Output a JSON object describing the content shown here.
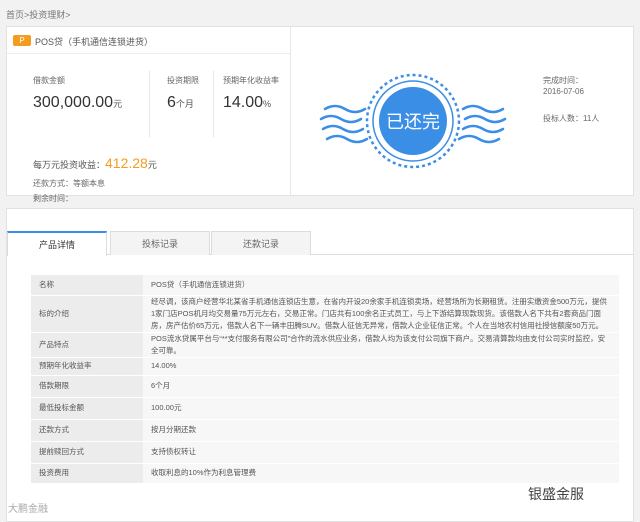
{
  "breadcrumb": {
    "home": "首页",
    "sep": ">",
    "section": "投资理财",
    "sep2": ">"
  },
  "product": {
    "badge": "P",
    "title": "POS贷（手机通信连锁进货）"
  },
  "stats": {
    "amount_label": "借款金额",
    "amount_value": "300,000.00",
    "amount_unit": "元",
    "term_label": "投资期限",
    "term_value": "6",
    "term_unit": "个月",
    "rate_label": "预期年化收益率",
    "rate_value": "14.00",
    "rate_unit": "%"
  },
  "earn": {
    "label": "每万元投资收益：",
    "value": "412.28",
    "unit": "元"
  },
  "repay": {
    "label": "还款方式：",
    "value": "等额本息"
  },
  "remain": {
    "label": "剩余时间：",
    "value": ""
  },
  "stamp": {
    "text": "已还完"
  },
  "done": {
    "time_label": "完成时间：",
    "time_value": "2016-07-06",
    "investors": "投标人数：11人"
  },
  "tabs": [
    "产品详情",
    "投标记录",
    "还款记录"
  ],
  "details": [
    {
      "k": "名称",
      "v": "POS贷（手机通信连锁进货）"
    },
    {
      "k": "标的介绍",
      "v": "经尽调，该商户经营华北某省手机通信连锁店生意，在省内开设20余家手机连锁卖场，经营场所为长期租赁。注册实缴资金500万元，提供1家门店POS机月均交易量75万元左右，交易正常。门店共有100余名正式员工，与上下游结算现款现货。该借款人名下共有2套商品门面房，房产估价65万元，借款人名下一辆丰田腾SUV。借款人征信无异常，借款人企业征信正常。个人在当地农村信用社授信额度50万元。"
    },
    {
      "k": "产品特点",
      "v": "POS流水贷属平台与“**支付服务有限公司”合作的流水供应业务，借款人均为该支付公司旗下商户。交易清算款均由支付公司实时监控，安全可靠。"
    },
    {
      "k": "预期年化收益率",
      "v": "14.00%"
    },
    {
      "k": "借款期限",
      "v": "6个月"
    },
    {
      "k": "最低投标金额",
      "v": "100.00元"
    },
    {
      "k": "还款方式",
      "v": "按月分期还款"
    },
    {
      "k": "提前赎回方式",
      "v": "支持债权转让"
    },
    {
      "k": "投资费用",
      "v": "收取利息的10%作为利息管理费"
    }
  ],
  "watermarks": {
    "left": "大鹏金融",
    "right": "银盛金服"
  }
}
